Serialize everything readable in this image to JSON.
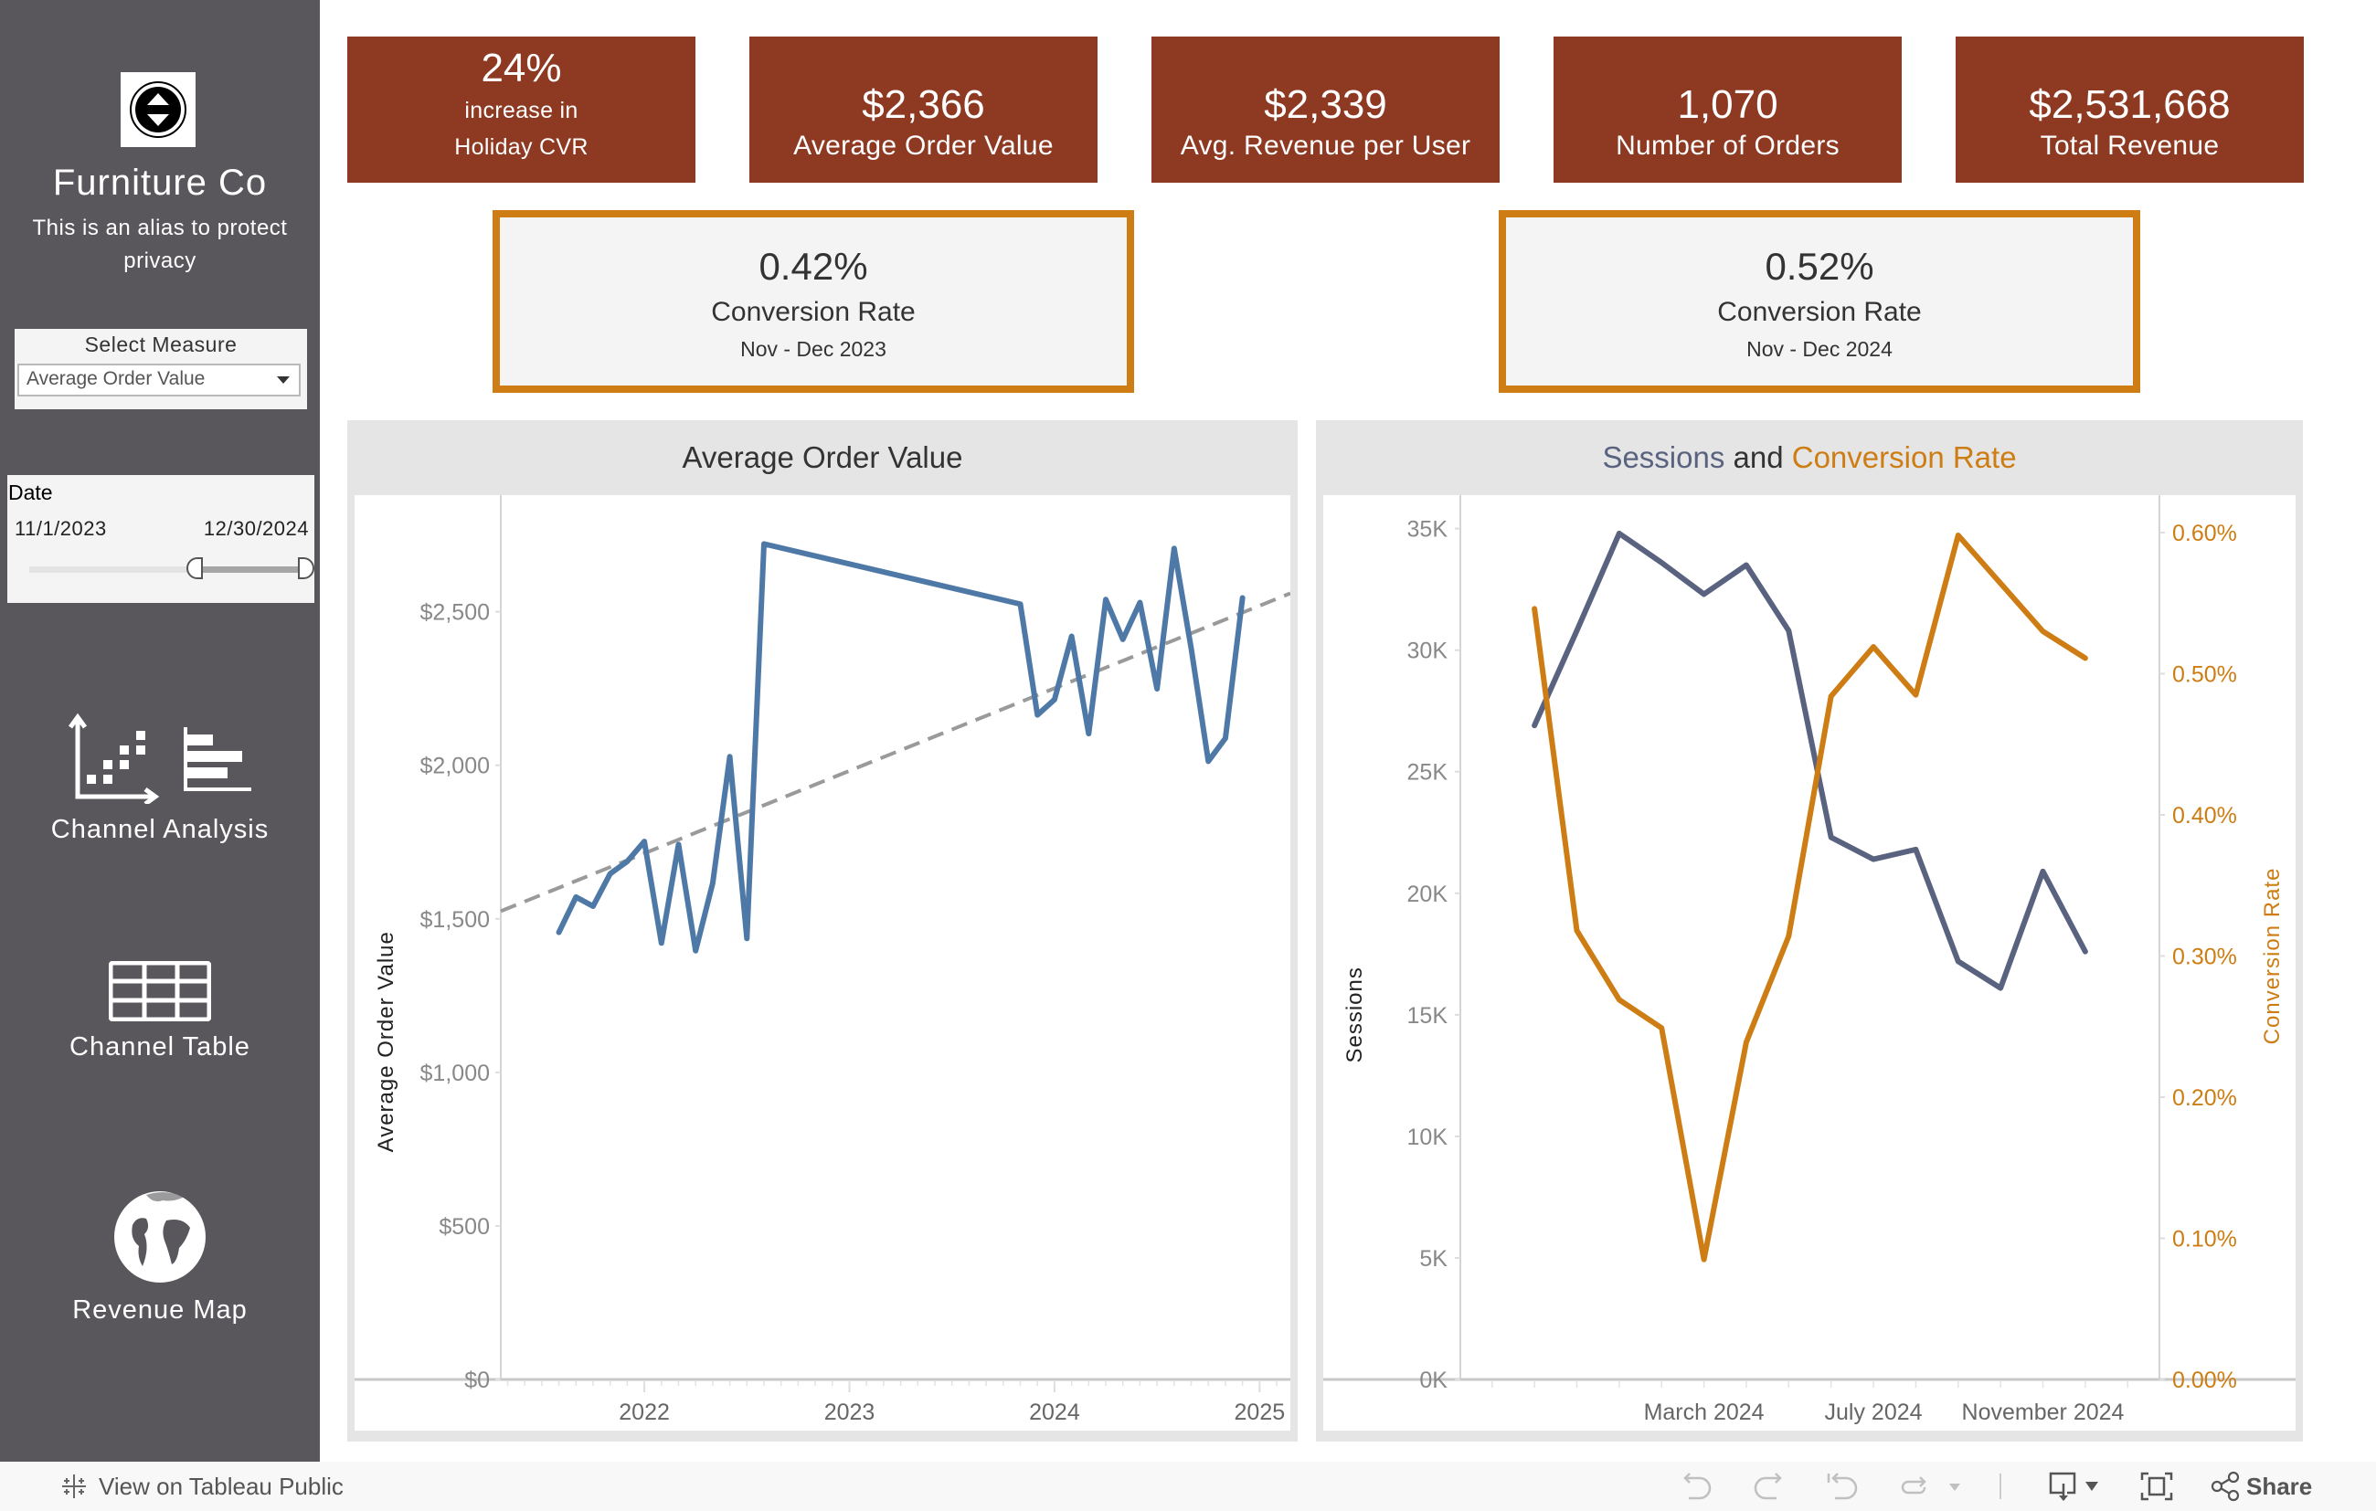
{
  "sidebar": {
    "logo_icon": "up-down-circle-icon",
    "brand_title": "Furniture Co",
    "brand_subtitle": "This is an alias to protect privacy",
    "measure_filter": {
      "label": "Select Measure",
      "selected": "Average Order Value"
    },
    "date_filter": {
      "label": "Date",
      "start": "11/1/2023",
      "end": "12/30/2024",
      "range_fraction": [
        0.59,
        1.0
      ]
    },
    "nav": [
      {
        "label": "Channel Analysis",
        "icon": "scatter-bar-chart-icon"
      },
      {
        "label": "Channel Table",
        "icon": "table-grid-icon"
      },
      {
        "label": "Revenue Map",
        "icon": "globe-icon"
      }
    ]
  },
  "kpis": [
    {
      "value": "24%",
      "label_line1": "increase in",
      "label_line2": "Holiday CVR"
    },
    {
      "value": "$2,366",
      "label": "Average Order Value"
    },
    {
      "value": "$2,339",
      "label": "Avg. Revenue per User"
    },
    {
      "value": "1,070",
      "label": "Number of Orders"
    },
    {
      "value": "$2,531,668",
      "label": "Total Revenue"
    }
  ],
  "cvr_cards": [
    {
      "value": "0.42%",
      "label": "Conversion Rate",
      "period": "Nov - Dec 2023"
    },
    {
      "value": "0.52%",
      "label": "Conversion Rate",
      "period": "Nov - Dec 2024"
    }
  ],
  "colors": {
    "kpi_bg": "#8e3921",
    "cvr_border": "#cd7d13",
    "sidebar_bg": "#59575b",
    "aov_line": "#4e79a7",
    "sessions_line": "#59627f",
    "cvr_line": "#cd7d13",
    "trend_line": "#9a9a9a"
  },
  "chart_data": [
    {
      "type": "line",
      "title": "Average Order Value",
      "xlabel": "",
      "ylabel": "Average Order Value",
      "x_ticks": [
        "2022",
        "2023",
        "2024",
        "2025"
      ],
      "y_ticks": [
        "$0",
        "$500",
        "$1,000",
        "$1,500",
        "$2,000",
        "$2,500"
      ],
      "ylim": [
        0,
        2850
      ],
      "xlim_years": [
        2021.3,
        2025.15
      ],
      "grid": false,
      "trend_line": {
        "style": "dashed",
        "start": [
          2021.3,
          1525
        ],
        "end": [
          2025.15,
          2560
        ]
      },
      "series": [
        {
          "name": "Average Order Value",
          "x": [
            "2021-08",
            "2021-09",
            "2021-10",
            "2021-11",
            "2021-12",
            "2022-01",
            "2022-02",
            "2022-03",
            "2022-04",
            "2022-05",
            "2022-06",
            "2022-07",
            "2022-08",
            "2023-11",
            "2023-12",
            "2024-01",
            "2024-02",
            "2024-03",
            "2024-04",
            "2024-05",
            "2024-06",
            "2024-07",
            "2024-08",
            "2024-09",
            "2024-10",
            "2024-11",
            "2024-12"
          ],
          "values": [
            1456,
            1571,
            1541,
            1647,
            1687,
            1752,
            1421,
            1742,
            1396,
            1616,
            2028,
            1436,
            2721,
            2525,
            2164,
            2214,
            2420,
            2103,
            2540,
            2410,
            2530,
            2249,
            2706,
            2380,
            2013,
            2088,
            2545
          ]
        }
      ]
    },
    {
      "type": "line",
      "title": "Sessions and Conversion Rate",
      "title_parts": [
        "Sessions",
        " and ",
        "Conversion Rate"
      ],
      "xlabel": "",
      "x_ticks": [
        "March 2024",
        "July 2024",
        "November 2024"
      ],
      "categories": [
        "Nov 2023",
        "Dec 2023",
        "Jan 2024",
        "Feb 2024",
        "Mar 2024",
        "Apr 2024",
        "May 2024",
        "Jun 2024",
        "Jul 2024",
        "Aug 2024",
        "Sep 2024",
        "Oct 2024",
        "Nov 2024",
        "Dec 2024"
      ],
      "y_left": {
        "label": "Sessions",
        "ticks": [
          "0K",
          "5K",
          "10K",
          "15K",
          "20K",
          "25K",
          "30K",
          "35K"
        ],
        "lim": [
          0,
          36000
        ]
      },
      "y_right": {
        "label": "Conversion Rate",
        "ticks": [
          "0.00%",
          "0.10%",
          "0.20%",
          "0.30%",
          "0.40%",
          "0.50%",
          "0.60%"
        ],
        "lim": [
          0,
          0.62
        ]
      },
      "series": [
        {
          "name": "Sessions",
          "axis": "left",
          "values": [
            26900,
            30800,
            34800,
            33600,
            32300,
            33500,
            30800,
            22300,
            21400,
            21800,
            17200,
            16100,
            20900,
            17600
          ]
        },
        {
          "name": "Conversion Rate",
          "axis": "right",
          "values": [
            0.546,
            0.318,
            0.269,
            0.249,
            0.085,
            0.239,
            0.314,
            0.484,
            0.519,
            0.485,
            0.598,
            0.564,
            0.53,
            0.511
          ]
        }
      ]
    }
  ],
  "toolbar": {
    "view_on": "View on Tableau Public",
    "share": "Share",
    "icons": [
      "undo-icon",
      "redo-icon",
      "revert-icon",
      "refresh-icon",
      "dropdown-icon",
      "download-icon",
      "fullscreen-icon",
      "share-icon"
    ]
  }
}
